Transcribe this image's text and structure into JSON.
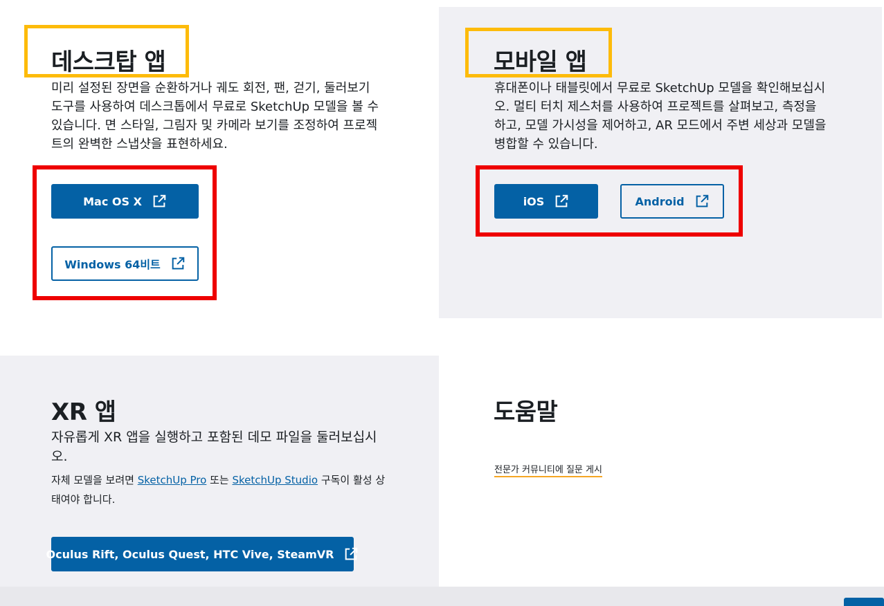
{
  "desktop": {
    "title": "데스크탑 앱",
    "description": "미리 설정된 장면을 순환하거나 궤도 회전, 팬, 걷기, 둘러보기 도구를 사용하여 데스크톱에서 무료로 SketchUp 모델을 볼 수 있습니다. 면 스타일, 그림자 및 카메라 보기를 조정하여 프로젝트의 완벽한 스냅샷을 표현하세요.",
    "buttons": {
      "mac": "Mac OS X",
      "windows": "Windows 64비트"
    }
  },
  "mobile": {
    "title": "모바일 앱",
    "description": "휴대폰이나 태블릿에서 무료로 SketchUp 모델을 확인해보십시오. 멀티 터치 제스처를 사용하여 프로젝트를 살펴보고, 측정을 하고, 모델 가시성을 제어하고, AR 모드에서 주변 세상과 모델을 병합할 수 있습니다.",
    "buttons": {
      "ios": "iOS",
      "android": "Android"
    }
  },
  "xr": {
    "title": "XR 앱",
    "description": "자유롭게 XR 앱을 실행하고 포함된 데모 파일을 둘러보십시오.",
    "note_prefix": "자체 모델을 보려면 ",
    "link_pro": "SketchUp Pro",
    "note_middle": " 또는 ",
    "link_studio": "SketchUp Studio",
    "note_suffix": " 구독이 활성 상태여야 합니다.",
    "button": "Oculus Rift, Oculus Quest, HTC Vive, SteamVR"
  },
  "help": {
    "title": "도움말",
    "link": "전문가 커뮤니티에 질문 게시"
  },
  "icons": {
    "external_link": "external-link-icon"
  },
  "colors": {
    "primary": "#0461a5",
    "panel_gray": "#f0f0f4",
    "highlight_yellow": "#fdbb0a",
    "highlight_red": "#ee0000",
    "link_underline": "#f5a623"
  }
}
